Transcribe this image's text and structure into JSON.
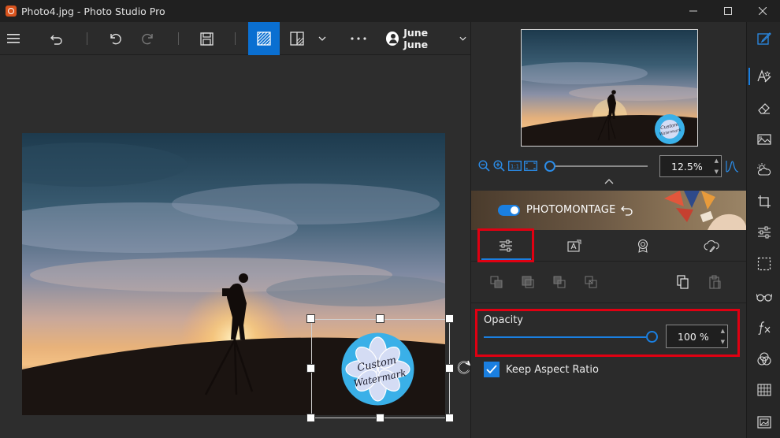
{
  "window": {
    "title": "Photo4.jpg - Photo Studio Pro",
    "icons": [
      "app-icon",
      "minimize-icon",
      "maximize-icon",
      "close-icon"
    ]
  },
  "toolbar": {
    "icons": [
      "hamburger-menu-icon",
      "undo-history-icon",
      "undo-icon",
      "redo-icon",
      "save-icon",
      "view-single-icon",
      "view-compare-icon",
      "chevron-down-icon",
      "more-icon",
      "user-avatar-icon"
    ],
    "user_name": "June June"
  },
  "zoom": {
    "value": "12.5%",
    "slider_position": 0.0,
    "icons": [
      "zoom-out-icon",
      "zoom-in-icon",
      "actual-size-icon",
      "fit-icon",
      "histogram-icon"
    ]
  },
  "banner": {
    "label": "PHOTOMONTAGE",
    "toggle_on": true
  },
  "tabs": [
    {
      "icon": "adjust-sliders-icon",
      "active": true
    },
    {
      "icon": "text-frame-icon",
      "active": false
    },
    {
      "icon": "badge-icon",
      "active": false
    },
    {
      "icon": "cloud-brush-icon",
      "active": false
    }
  ],
  "opacity": {
    "label": "Opacity",
    "value": "100 %",
    "level": 1.0
  },
  "keep_aspect": {
    "label": "Keep Aspect Ratio",
    "checked": true
  },
  "watermark": {
    "text_line1": "Custom",
    "text_line2": "Watermark"
  },
  "colors": {
    "accent": "#1a7fe0",
    "highlight_red": "#e00012",
    "background": "#2b2b2b",
    "titlebar": "#202020"
  },
  "sidebar": {
    "icons": [
      "edit-icon",
      "magic-text-icon",
      "eraser-icon",
      "photo-filter-icon",
      "weather-icon",
      "crop-icon",
      "sliders-icon",
      "selection-icon",
      "glasses-icon",
      "fx-icon",
      "color-circles-icon",
      "mosaic-icon",
      "frame-icon"
    ]
  }
}
